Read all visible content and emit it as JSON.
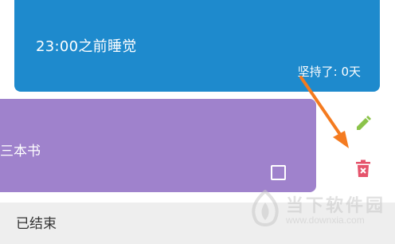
{
  "habit_cards": [
    {
      "title": "23:00之前睡觉",
      "streak": "坚持了: 0天",
      "color": "#1e8acd"
    },
    {
      "title": "三本书",
      "color": "#9f82cc",
      "checked": false
    }
  ],
  "actions": {
    "edit_icon": "pencil-icon",
    "delete_icon": "trash-icon",
    "edit_color": "#8bc34a",
    "delete_color": "#e5536b"
  },
  "section": {
    "ended_label": "已结束"
  },
  "annotation": {
    "arrow_color": "#f47b20"
  },
  "watermark": {
    "brand": "当下软件园",
    "url": "www.downxia.com"
  }
}
